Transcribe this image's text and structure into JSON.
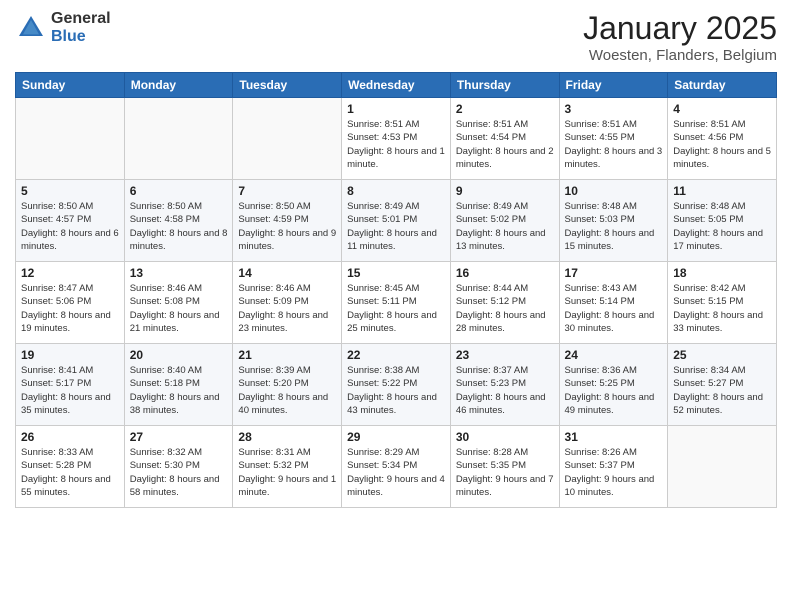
{
  "logo": {
    "general": "General",
    "blue": "Blue"
  },
  "header": {
    "title": "January 2025",
    "subtitle": "Woesten, Flanders, Belgium"
  },
  "weekdays": [
    "Sunday",
    "Monday",
    "Tuesday",
    "Wednesday",
    "Thursday",
    "Friday",
    "Saturday"
  ],
  "weeks": [
    [
      {
        "day": "",
        "sunrise": "",
        "sunset": "",
        "daylight": ""
      },
      {
        "day": "",
        "sunrise": "",
        "sunset": "",
        "daylight": ""
      },
      {
        "day": "",
        "sunrise": "",
        "sunset": "",
        "daylight": ""
      },
      {
        "day": "1",
        "sunrise": "Sunrise: 8:51 AM",
        "sunset": "Sunset: 4:53 PM",
        "daylight": "Daylight: 8 hours and 1 minute."
      },
      {
        "day": "2",
        "sunrise": "Sunrise: 8:51 AM",
        "sunset": "Sunset: 4:54 PM",
        "daylight": "Daylight: 8 hours and 2 minutes."
      },
      {
        "day": "3",
        "sunrise": "Sunrise: 8:51 AM",
        "sunset": "Sunset: 4:55 PM",
        "daylight": "Daylight: 8 hours and 3 minutes."
      },
      {
        "day": "4",
        "sunrise": "Sunrise: 8:51 AM",
        "sunset": "Sunset: 4:56 PM",
        "daylight": "Daylight: 8 hours and 5 minutes."
      }
    ],
    [
      {
        "day": "5",
        "sunrise": "Sunrise: 8:50 AM",
        "sunset": "Sunset: 4:57 PM",
        "daylight": "Daylight: 8 hours and 6 minutes."
      },
      {
        "day": "6",
        "sunrise": "Sunrise: 8:50 AM",
        "sunset": "Sunset: 4:58 PM",
        "daylight": "Daylight: 8 hours and 8 minutes."
      },
      {
        "day": "7",
        "sunrise": "Sunrise: 8:50 AM",
        "sunset": "Sunset: 4:59 PM",
        "daylight": "Daylight: 8 hours and 9 minutes."
      },
      {
        "day": "8",
        "sunrise": "Sunrise: 8:49 AM",
        "sunset": "Sunset: 5:01 PM",
        "daylight": "Daylight: 8 hours and 11 minutes."
      },
      {
        "day": "9",
        "sunrise": "Sunrise: 8:49 AM",
        "sunset": "Sunset: 5:02 PM",
        "daylight": "Daylight: 8 hours and 13 minutes."
      },
      {
        "day": "10",
        "sunrise": "Sunrise: 8:48 AM",
        "sunset": "Sunset: 5:03 PM",
        "daylight": "Daylight: 8 hours and 15 minutes."
      },
      {
        "day": "11",
        "sunrise": "Sunrise: 8:48 AM",
        "sunset": "Sunset: 5:05 PM",
        "daylight": "Daylight: 8 hours and 17 minutes."
      }
    ],
    [
      {
        "day": "12",
        "sunrise": "Sunrise: 8:47 AM",
        "sunset": "Sunset: 5:06 PM",
        "daylight": "Daylight: 8 hours and 19 minutes."
      },
      {
        "day": "13",
        "sunrise": "Sunrise: 8:46 AM",
        "sunset": "Sunset: 5:08 PM",
        "daylight": "Daylight: 8 hours and 21 minutes."
      },
      {
        "day": "14",
        "sunrise": "Sunrise: 8:46 AM",
        "sunset": "Sunset: 5:09 PM",
        "daylight": "Daylight: 8 hours and 23 minutes."
      },
      {
        "day": "15",
        "sunrise": "Sunrise: 8:45 AM",
        "sunset": "Sunset: 5:11 PM",
        "daylight": "Daylight: 8 hours and 25 minutes."
      },
      {
        "day": "16",
        "sunrise": "Sunrise: 8:44 AM",
        "sunset": "Sunset: 5:12 PM",
        "daylight": "Daylight: 8 hours and 28 minutes."
      },
      {
        "day": "17",
        "sunrise": "Sunrise: 8:43 AM",
        "sunset": "Sunset: 5:14 PM",
        "daylight": "Daylight: 8 hours and 30 minutes."
      },
      {
        "day": "18",
        "sunrise": "Sunrise: 8:42 AM",
        "sunset": "Sunset: 5:15 PM",
        "daylight": "Daylight: 8 hours and 33 minutes."
      }
    ],
    [
      {
        "day": "19",
        "sunrise": "Sunrise: 8:41 AM",
        "sunset": "Sunset: 5:17 PM",
        "daylight": "Daylight: 8 hours and 35 minutes."
      },
      {
        "day": "20",
        "sunrise": "Sunrise: 8:40 AM",
        "sunset": "Sunset: 5:18 PM",
        "daylight": "Daylight: 8 hours and 38 minutes."
      },
      {
        "day": "21",
        "sunrise": "Sunrise: 8:39 AM",
        "sunset": "Sunset: 5:20 PM",
        "daylight": "Daylight: 8 hours and 40 minutes."
      },
      {
        "day": "22",
        "sunrise": "Sunrise: 8:38 AM",
        "sunset": "Sunset: 5:22 PM",
        "daylight": "Daylight: 8 hours and 43 minutes."
      },
      {
        "day": "23",
        "sunrise": "Sunrise: 8:37 AM",
        "sunset": "Sunset: 5:23 PM",
        "daylight": "Daylight: 8 hours and 46 minutes."
      },
      {
        "day": "24",
        "sunrise": "Sunrise: 8:36 AM",
        "sunset": "Sunset: 5:25 PM",
        "daylight": "Daylight: 8 hours and 49 minutes."
      },
      {
        "day": "25",
        "sunrise": "Sunrise: 8:34 AM",
        "sunset": "Sunset: 5:27 PM",
        "daylight": "Daylight: 8 hours and 52 minutes."
      }
    ],
    [
      {
        "day": "26",
        "sunrise": "Sunrise: 8:33 AM",
        "sunset": "Sunset: 5:28 PM",
        "daylight": "Daylight: 8 hours and 55 minutes."
      },
      {
        "day": "27",
        "sunrise": "Sunrise: 8:32 AM",
        "sunset": "Sunset: 5:30 PM",
        "daylight": "Daylight: 8 hours and 58 minutes."
      },
      {
        "day": "28",
        "sunrise": "Sunrise: 8:31 AM",
        "sunset": "Sunset: 5:32 PM",
        "daylight": "Daylight: 9 hours and 1 minute."
      },
      {
        "day": "29",
        "sunrise": "Sunrise: 8:29 AM",
        "sunset": "Sunset: 5:34 PM",
        "daylight": "Daylight: 9 hours and 4 minutes."
      },
      {
        "day": "30",
        "sunrise": "Sunrise: 8:28 AM",
        "sunset": "Sunset: 5:35 PM",
        "daylight": "Daylight: 9 hours and 7 minutes."
      },
      {
        "day": "31",
        "sunrise": "Sunrise: 8:26 AM",
        "sunset": "Sunset: 5:37 PM",
        "daylight": "Daylight: 9 hours and 10 minutes."
      },
      {
        "day": "",
        "sunrise": "",
        "sunset": "",
        "daylight": ""
      }
    ]
  ]
}
